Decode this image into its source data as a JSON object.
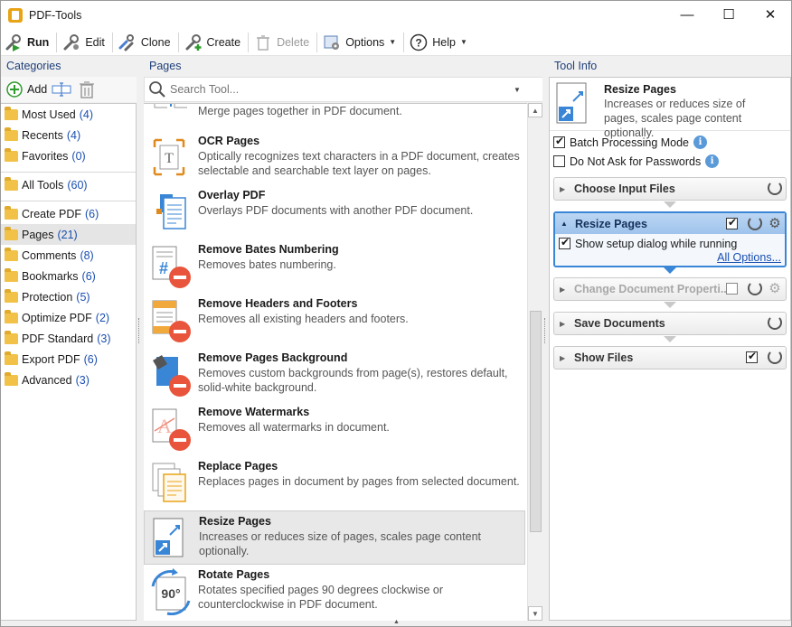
{
  "window": {
    "title": "PDF-Tools",
    "controls": {
      "minimize": "—",
      "maximize": "☐",
      "close": "✕"
    }
  },
  "toolbar": {
    "run": "Run",
    "edit": "Edit",
    "clone": "Clone",
    "create": "Create",
    "delete": "Delete",
    "options": "Options",
    "help": "Help"
  },
  "categories": {
    "header": "Categories",
    "add": "Add",
    "items": [
      {
        "label": "Most Used",
        "count": "(4)"
      },
      {
        "label": "Recents",
        "count": "(4)"
      },
      {
        "label": "Favorites",
        "count": "(0)"
      },
      {
        "label": "All Tools",
        "count": "(60)"
      },
      {
        "label": "Create PDF",
        "count": "(6)"
      },
      {
        "label": "Pages",
        "count": "(21)"
      },
      {
        "label": "Comments",
        "count": "(8)"
      },
      {
        "label": "Bookmarks",
        "count": "(6)"
      },
      {
        "label": "Protection",
        "count": "(5)"
      },
      {
        "label": "Optimize PDF",
        "count": "(2)"
      },
      {
        "label": "PDF Standard",
        "count": "(3)"
      },
      {
        "label": "Export PDF",
        "count": "(6)"
      },
      {
        "label": "Advanced",
        "count": "(3)"
      }
    ]
  },
  "pages": {
    "header": "Pages",
    "search_placeholder": "Search Tool...",
    "partial_desc": "Merge pages together in PDF document.",
    "tools": [
      {
        "name": "OCR Pages",
        "desc": "Optically recognizes text characters in a PDF document, creates selectable and searchable text layer on pages.",
        "icon": "ocr-icon"
      },
      {
        "name": "Overlay PDF",
        "desc": "Overlays PDF documents with another PDF document.",
        "icon": "overlay-icon"
      },
      {
        "name": "Remove Bates Numbering",
        "desc": "Removes bates numbering.",
        "icon": "remove-bates-icon"
      },
      {
        "name": "Remove Headers and Footers",
        "desc": "Removes all existing headers and footers.",
        "icon": "remove-headers-icon"
      },
      {
        "name": "Remove Pages Background",
        "desc": "Removes custom backgrounds from page(s), restores default, solid-white background.",
        "icon": "remove-background-icon"
      },
      {
        "name": "Remove Watermarks",
        "desc": "Removes all watermarks in document.",
        "icon": "remove-watermarks-icon"
      },
      {
        "name": "Replace Pages",
        "desc": "Replaces pages in document by pages from selected document.",
        "icon": "replace-pages-icon"
      },
      {
        "name": "Resize Pages",
        "desc": "Increases or reduces size of pages, scales page content optionally.",
        "icon": "resize-pages-icon"
      },
      {
        "name": "Rotate Pages",
        "desc": "Rotates specified pages 90 degrees clockwise or counterclockwise in PDF document.",
        "icon": "rotate-pages-icon"
      }
    ]
  },
  "tool_info": {
    "header": "Tool Info",
    "title": "Resize Pages",
    "desc": "Increases or reduces size of pages, scales page content optionally.",
    "batch": "Batch Processing Mode",
    "no_ask": "Do Not Ask for Passwords",
    "steps": {
      "choose": "Choose Input Files",
      "resize": "Resize Pages",
      "resize_option": "Show setup dialog while running",
      "all_options": "All Options...",
      "change": "Change Document Properti...",
      "save": "Save Documents",
      "show": "Show Files"
    }
  }
}
